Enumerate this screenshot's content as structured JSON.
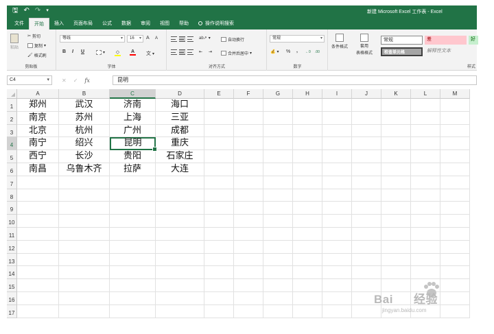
{
  "window": {
    "title": "新建 Microsoft Excel 工作表 - Excel"
  },
  "quick_access": {
    "save_icon": "save-icon",
    "undo_icon": "undo-icon",
    "redo_icon": "redo-icon",
    "customize_icon": "customize-icon"
  },
  "tabs": [
    "文件",
    "开始",
    "插入",
    "页面布局",
    "公式",
    "数据",
    "审阅",
    "视图",
    "帮助",
    "操作说明搜索"
  ],
  "active_tab": "开始",
  "ribbon": {
    "clipboard": {
      "paste": "粘贴",
      "cut": "剪切",
      "copy": "复制",
      "format_painter": "格式刷",
      "label": "剪贴板"
    },
    "font": {
      "font_name": "等线",
      "font_size": "16",
      "grow": "A",
      "shrink": "A",
      "bold": "B",
      "italic": "I",
      "underline": "U",
      "font_color": "A",
      "label": "字体"
    },
    "alignment": {
      "wrap_text": "自动换行",
      "merge_center": "合并后居中",
      "label": "对齐方式"
    },
    "number": {
      "format": "常规",
      "percent": "%",
      "comma": ",",
      "label": "数字"
    },
    "styles": {
      "conditional": "条件格式",
      "table_format_1": "套用",
      "table_format_2": "表格格式",
      "normal": "常规",
      "bad": "差",
      "good": "好",
      "check_cell": "检查单元格",
      "explanatory": "解释性文本",
      "label": "样式"
    }
  },
  "formula_bar": {
    "name_box": "C4",
    "cancel": "✕",
    "enter": "✓",
    "fx": "fx",
    "content": "昆明"
  },
  "columns": [
    "A",
    "B",
    "C",
    "D",
    "E",
    "F",
    "G",
    "H",
    "I",
    "J",
    "K",
    "L",
    "M"
  ],
  "rows": [
    "1",
    "2",
    "3",
    "4",
    "5",
    "6",
    "7",
    "8",
    "9",
    "10",
    "11",
    "12",
    "13",
    "14",
    "15",
    "16",
    "17"
  ],
  "cells": [
    [
      "郑州",
      "武汉",
      "济南",
      "海口"
    ],
    [
      "南京",
      "苏州",
      "上海",
      "三亚"
    ],
    [
      "北京",
      "杭州",
      "广州",
      "成都"
    ],
    [
      "南宁",
      "绍兴",
      "昆明",
      "重庆"
    ],
    [
      "西宁",
      "长沙",
      "贵阳",
      "石家庄"
    ],
    [
      "南昌",
      "乌鲁木齐",
      "拉萨",
      "大连"
    ]
  ],
  "active_cell": "C4",
  "watermark": {
    "brand": "Bai",
    "brand2": "经验",
    "url": "jingyan.baidu.com"
  },
  "colors": {
    "excel_green": "#217346",
    "bad_fill": "#ffc7ce",
    "bad_text": "#9c0006",
    "good_fill": "#c6efce",
    "good_text": "#006100",
    "check_fill": "#a5a5a5"
  }
}
